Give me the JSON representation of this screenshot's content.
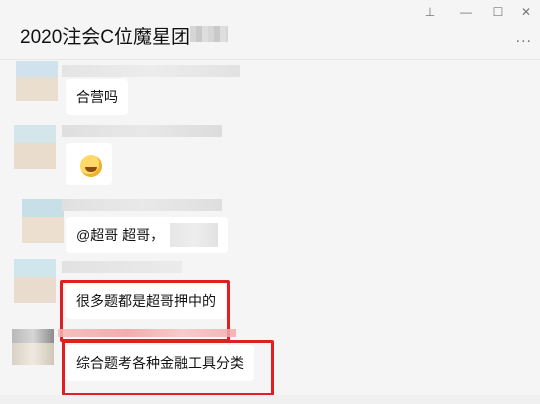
{
  "window": {
    "title": "2020注会C位魔星团",
    "pin_glyph": "⊥",
    "minimize_glyph": "—",
    "maximize_glyph": "☐",
    "close_glyph": "✕",
    "more_glyph": "..."
  },
  "messages": [
    {
      "text": "合营吗"
    },
    {
      "emoji": "laughing-emoji"
    },
    {
      "text": "@超哥 超哥，"
    },
    {
      "text": "很多题都是超哥押中的"
    },
    {
      "text": "综合题考各种金融工具分类"
    }
  ],
  "colors": {
    "background": "#f5f5f5",
    "bubble": "#ffffff",
    "highlight": "#e02020"
  }
}
